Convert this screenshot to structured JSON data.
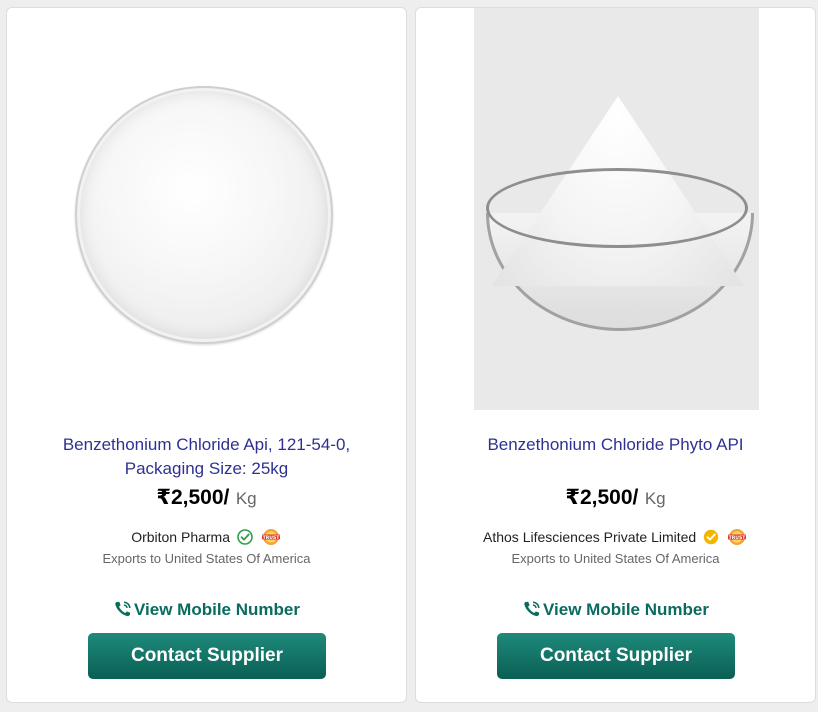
{
  "products": [
    {
      "title_line1": "Benzethonium Chloride Api, 121-54-0,",
      "title_line2": "Packaging Size: 25kg",
      "price": "₹2,500/",
      "unit": "Kg",
      "supplier": "Orbiton Pharma",
      "exports": "Exports to United States Of America",
      "mobile_label": "View Mobile Number",
      "contact_label": "Contact Supplier",
      "verify_icon": "verified-check-icon",
      "tag_icon": "trust-seal-icon"
    },
    {
      "title_line1": "Benzethonium Chloride Phyto API",
      "title_line2": "",
      "price": "₹2,500/",
      "unit": "Kg",
      "supplier": "Athos Lifesciences Private Limited",
      "exports": "Exports to United States Of America",
      "mobile_label": "View Mobile Number",
      "contact_label": "Contact Supplier",
      "verify_icon": "gold-verified-icon",
      "tag_icon": "trust-seal-icon"
    }
  ],
  "colors": {
    "title": "#2e3192",
    "accent": "#0a6b5f",
    "button": "#0d6b5f"
  }
}
